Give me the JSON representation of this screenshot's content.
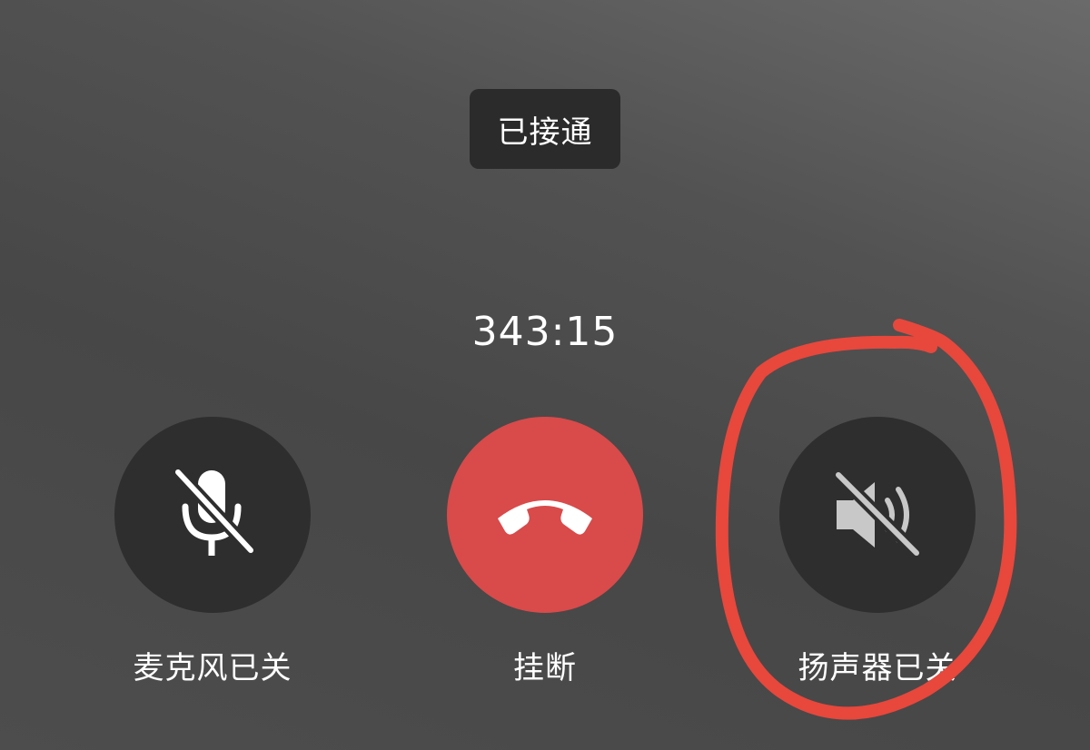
{
  "call": {
    "status": "已接通",
    "duration": "343:15"
  },
  "controls": {
    "mic": {
      "label": "麦克风已关",
      "icon": "mic-off-icon"
    },
    "hangup": {
      "label": "挂断",
      "icon": "phone-hangup-icon"
    },
    "speaker": {
      "label": "扬声器已关",
      "icon": "speaker-off-icon"
    }
  },
  "colors": {
    "hangup": "#d94a4a",
    "button": "#2e2e2e",
    "annotation": "#e8473c"
  }
}
